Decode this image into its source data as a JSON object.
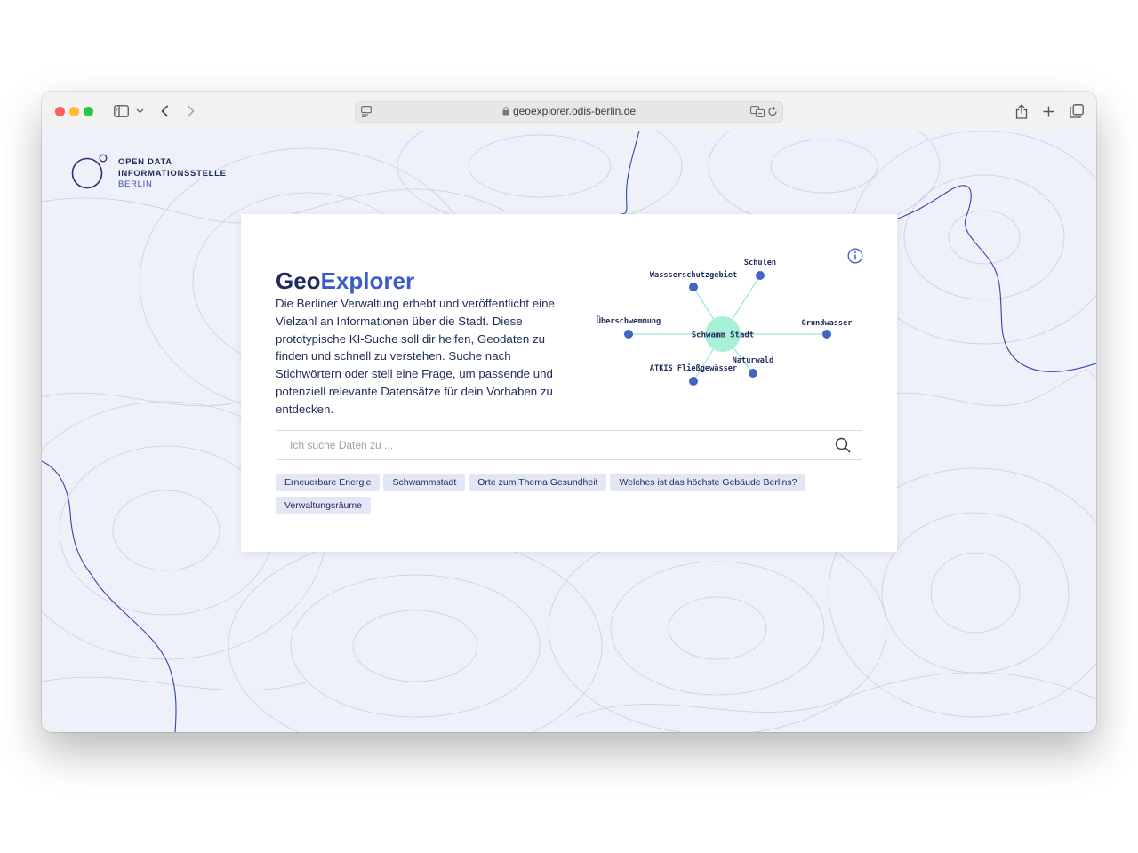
{
  "browser": {
    "url": "geoexplorer.odis-berlin.de"
  },
  "logo": {
    "line1": "OPEN DATA",
    "line2": "INFORMATIONSSTELLE",
    "line3": "BERLIN"
  },
  "card": {
    "title_part1": "Geo",
    "title_part2": "Explorer",
    "description": "Die Berliner Verwaltung erhebt und veröffentlicht eine Vielzahl an Informationen über die Stadt. Diese prototypische KI-Suche soll dir helfen, Geodaten zu finden und schnell zu verstehen. Suche nach Stichwörtern oder stell eine Frage, um passende und potenziell relevante Datensätze für dein Vorhaben zu entdecken."
  },
  "graph": {
    "center": "Schwamm Stadt",
    "nodes": [
      "Wassserschutzgebiet",
      "Schulen",
      "Überschwemmung",
      "Grundwasser",
      "Naturwald",
      "ATKIS Fließgewässer"
    ]
  },
  "search": {
    "placeholder": "Ich suche Daten zu ..."
  },
  "suggestions": [
    "Erneuerbare Energie",
    "Schwammstadt",
    "Orte zum Thema Gesundheit",
    "Welches ist das höchste Gebäude Berlins?",
    "Verwaltungsräume"
  ],
  "colors": {
    "primary_dark": "#1e2a5a",
    "accent_blue": "#3a5cc4",
    "node_blue": "#4262c7",
    "center_mint": "#a8f0d8",
    "edge_mint": "#9fe6d0",
    "chip_bg": "#e3e7f5",
    "page_bg": "#eef1fa"
  }
}
